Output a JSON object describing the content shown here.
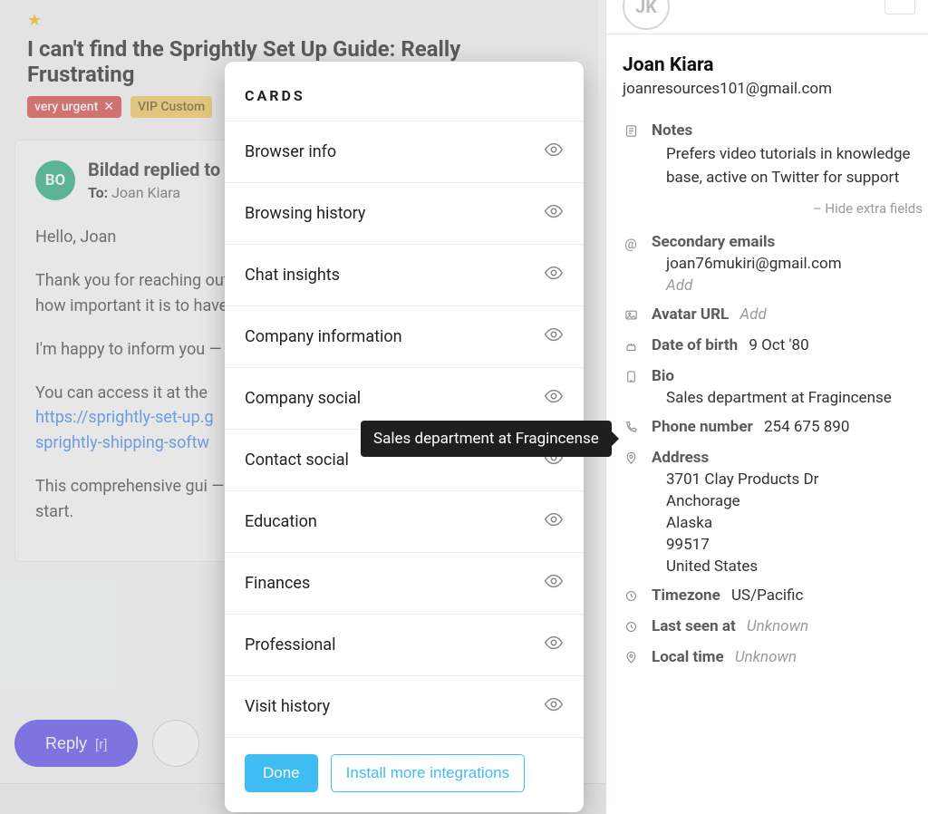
{
  "ticket": {
    "title": "I can't find the Sprightly Set Up Guide: Really Frustrating",
    "tags": {
      "urgent": "very urgent",
      "vip": "VIP Custom"
    }
  },
  "message": {
    "avatar_initials": "BO",
    "from_line": "Bildad replied to",
    "to_label": "To:",
    "to_name": "Joan Kiara",
    "p1": "Hello, Joan",
    "p2": "Thank you for reaching out, and I apologize for any frustration. I know how important it is to have — to ensure a smooth onboarding.",
    "p3": "I'm happy to inform you — website.",
    "p4": "You can access it at the",
    "link1": "https://sprightly-set-up.g",
    "link2": "sprightly-shipping-softw",
    "p5": "This comprehensive gui — process step-by-step, he — correctly from the start."
  },
  "actions": {
    "reply": "Reply",
    "reply_short": "[r]"
  },
  "sidebar": {
    "avatar_initials": "JK",
    "name": "Joan Kiara",
    "email": "joanresources101@gmail.com",
    "notes_label": "Notes",
    "notes_text": "Prefers video tutorials in knowledge base, active on Twitter for support",
    "hide_extra": "– Hide extra fields",
    "secondary_label": "Secondary emails",
    "secondary_value": "joan76mukiri@gmail.com",
    "add": "Add",
    "avatar_url_label": "Avatar URL",
    "dob_label": "Date of birth",
    "dob_value": "9 Oct '80",
    "bio_label": "Bio",
    "bio_value": "Sales department at Fragincense",
    "phone_label": "Phone number",
    "phone_value": "254 675 890",
    "address_label": "Address",
    "addr1": "3701 Clay Products Dr",
    "addr2": "Anchorage",
    "addr3": "Alaska",
    "addr4": "99517",
    "addr5": "United States",
    "tz_label": "Timezone",
    "tz_value": "US/Pacific",
    "lastseen_label": "Last seen at",
    "lastseen_value": "Unknown",
    "localtime_label": "Local time",
    "localtime_value": "Unknown"
  },
  "tooltip": {
    "text": "Sales department at Fragincense"
  },
  "modal": {
    "title": "CARDS",
    "cards": [
      "Browser info",
      "Browsing history",
      "Chat insights",
      "Company information",
      "Company social",
      "Contact social",
      "Education",
      "Finances",
      "Professional",
      "Visit history"
    ],
    "done": "Done",
    "install": "Install more integrations"
  }
}
